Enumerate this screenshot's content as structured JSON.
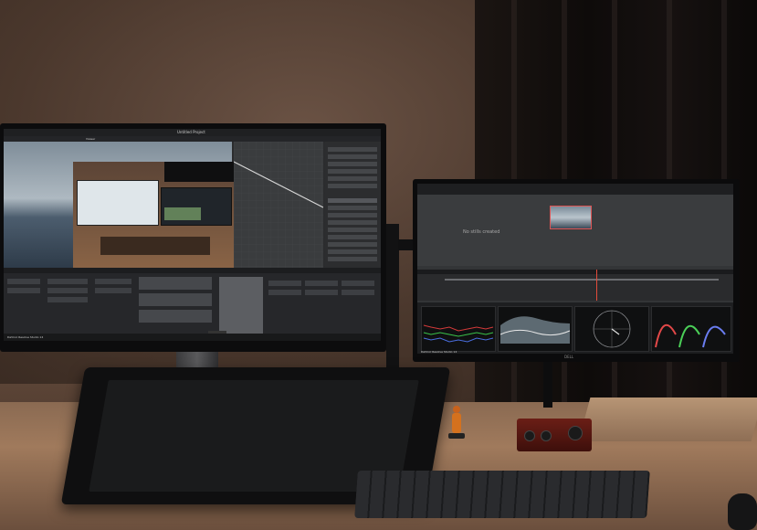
{
  "scene": {
    "description_free": true
  },
  "left_monitor": {
    "app_title": "Untitled Project",
    "viewer_label": "Viewer",
    "footer_label": "DaVinci Resolve Studio 14"
  },
  "right_monitor": {
    "stills_message": "No stills created",
    "footer_label": "DaVinci Resolve Studio 14",
    "brand_label": "DELL"
  },
  "colors": {
    "playhead": "#e24b3b",
    "wall": "#4b382d",
    "desk": "#a07a5c"
  }
}
